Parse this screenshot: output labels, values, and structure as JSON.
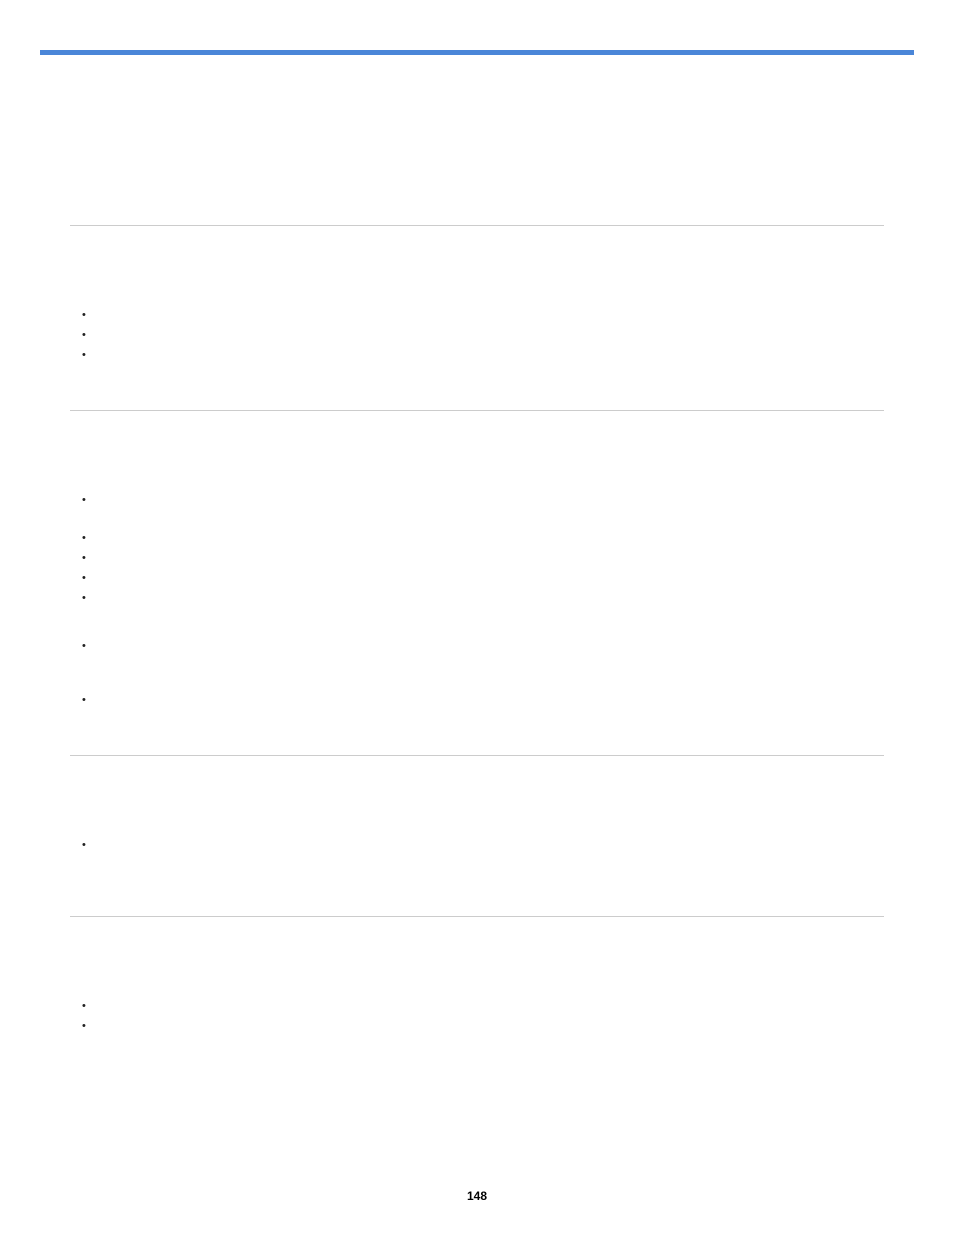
{
  "page_number": "148",
  "sections": [
    {
      "type": "empty"
    },
    {
      "type": "bullets",
      "prespace": "lg",
      "items": [
        {
          "text": ""
        },
        {
          "text": ""
        },
        {
          "text": ""
        }
      ],
      "postspace": "sm"
    },
    {
      "type": "bullets",
      "prespace": "lg",
      "items": [
        {
          "text": "",
          "gapAfter": 18
        },
        {
          "text": ""
        },
        {
          "text": ""
        },
        {
          "text": ""
        },
        {
          "text": "",
          "gapAfter": 28
        },
        {
          "text": "",
          "gapAfter": 34
        },
        {
          "text": ""
        }
      ],
      "postspace": "sm"
    },
    {
      "type": "bullets",
      "prespace": "lg",
      "items": [
        {
          "text": ""
        }
      ],
      "postspace": "md"
    },
    {
      "type": "bullets",
      "prespace": "lg",
      "items": [
        {
          "text": ""
        },
        {
          "text": ""
        }
      ],
      "postspace": "sm"
    }
  ]
}
